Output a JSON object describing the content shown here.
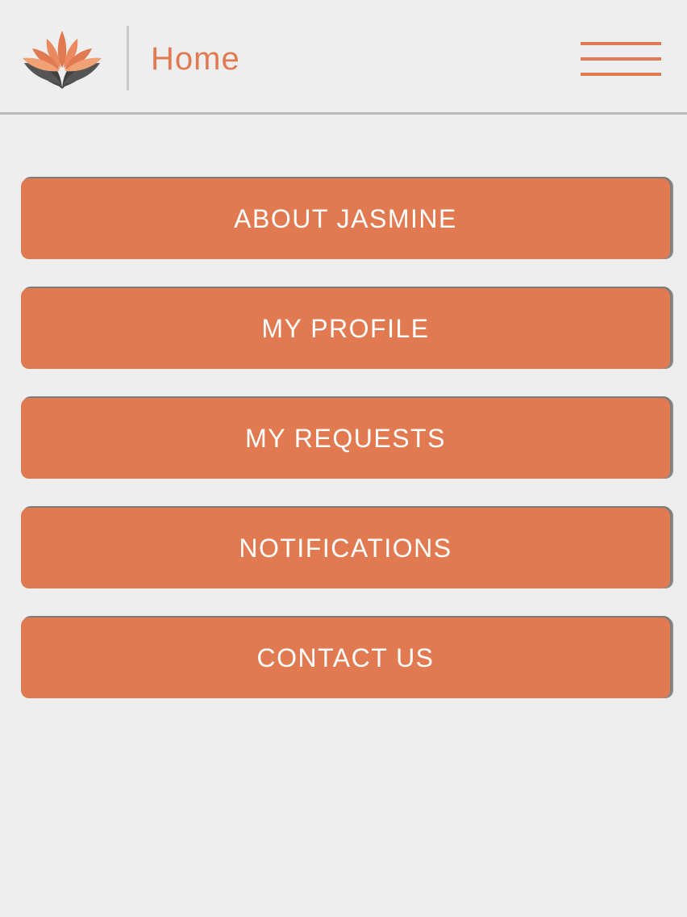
{
  "header": {
    "title": "Home",
    "logo_icon": "lotus-logo-icon",
    "menu_icon": "hamburger-menu-icon"
  },
  "colors": {
    "accent": "#e27a51",
    "background": "#efeeee",
    "logo_dark": "#3b3b3b",
    "button_text": "#ffffff"
  },
  "menu": {
    "items": [
      {
        "label": "ABOUT JASMINE"
      },
      {
        "label": "MY PROFILE"
      },
      {
        "label": "MY REQUESTS"
      },
      {
        "label": "NOTIFICATIONS"
      },
      {
        "label": "CONTACT US"
      }
    ]
  }
}
